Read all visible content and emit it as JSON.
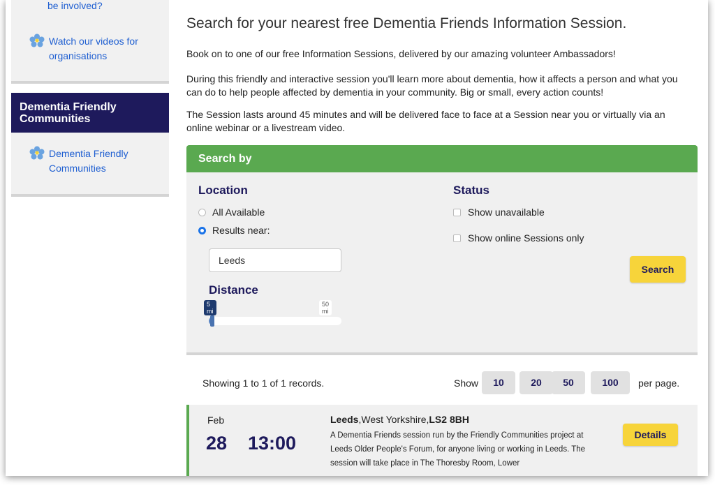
{
  "sidebar": {
    "clipped_text": "be involved?",
    "top_link": "Watch our videos for organisations",
    "heading": "Dementia Friendly Communities",
    "section_link": "Dementia Friendly Communities"
  },
  "main": {
    "title": "Search for your nearest free Dementia Friends Information Session.",
    "intro_1": "Book on to one of our free Information Sessions, delivered by our amazing volunteer Ambassadors!",
    "intro_2": "During this friendly and interactive session you'll learn more about dementia, how it affects a person and what you can do to help people affected by dementia in your community. Big or small, every action counts!",
    "intro_3": "The Session lasts around 45 minutes and will be delivered face to face at a Session near you or virtually via an online webinar or a livestream video."
  },
  "search": {
    "header": "Search by",
    "location_title": "Location",
    "option_all": "All Available",
    "option_near": "Results near:",
    "selected_option": "Results near:",
    "location_value": "Leeds",
    "distance_title": "Distance",
    "distance_min_label": "5 mi",
    "distance_max_label": "50 mi",
    "distance_value_fraction": 0.04,
    "status_title": "Status",
    "show_unavailable": "Show unavailable",
    "show_online": "Show online Sessions only",
    "search_button": "Search"
  },
  "results_bar": {
    "records_text": "Showing 1 to 1 of 1 records.",
    "show_label": "Show",
    "page_sizes": [
      "10",
      "20",
      "50",
      "100"
    ],
    "per_page_label": "per page."
  },
  "result": {
    "month": "Feb",
    "day": "28",
    "time": "13:00",
    "city": "Leeds",
    "county": ",West Yorkshire,",
    "postcode": "LS2 8BH",
    "description": "A Dementia Friends session run by the Friendly Communities project at Leeds Older People's Forum, for anyone living or working in Leeds. The session will take place in The Thoresby Room, Lower",
    "details_button": "Details"
  },
  "colors": {
    "brand_navy": "#1e1a5c",
    "green": "#5aa950",
    "yellow": "#f7d43a",
    "link_blue": "#1f5fd1"
  }
}
